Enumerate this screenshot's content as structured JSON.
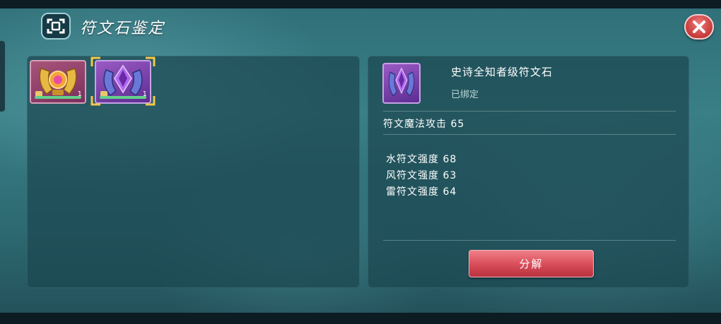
{
  "header": {
    "title": "符文石鉴定",
    "title_icon": "identify-scan-icon",
    "close_icon": "close-x-icon"
  },
  "inventory": {
    "slots": [
      {
        "icon": "gold-rune-emblem-icon",
        "rarity_color": "#a8547a",
        "count": "1"
      },
      {
        "icon": "purple-rune-crystal-icon",
        "rarity_color": "#9a5ac4",
        "count": "1",
        "selected": true
      }
    ]
  },
  "detail": {
    "icon": "purple-rune-crystal-icon",
    "name": "史诗全知者级符文石",
    "bound": "已绑定",
    "main_attr": "符文魔法攻击 65",
    "attrs": [
      "水符文强度 68",
      "风符文强度 63",
      "雷符文强度 64"
    ],
    "decompose_label": "分解"
  },
  "colors": {
    "accent_button": "#d84b58",
    "close_button": "#c63a3a",
    "panel": "#1c4650",
    "selection": "#f2c84b"
  }
}
